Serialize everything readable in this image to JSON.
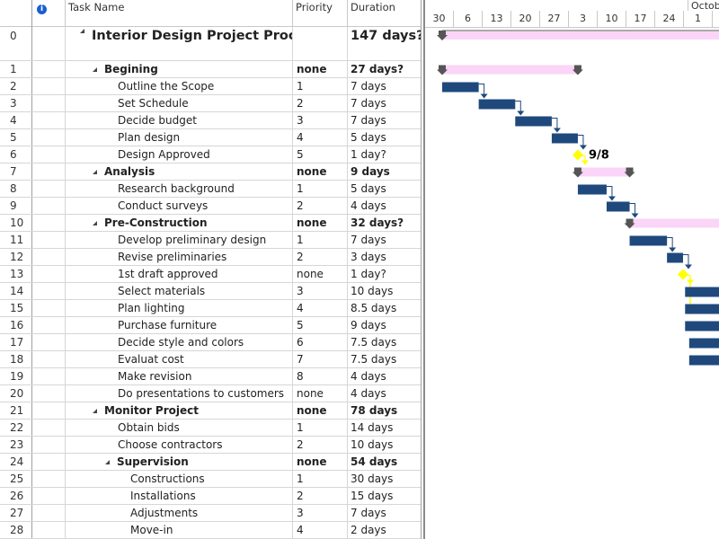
{
  "columns": {
    "id": "",
    "indicators_icon": "info-icon",
    "name": "Task Name",
    "priority": "Priority",
    "duration": "Duration"
  },
  "colors": {
    "task_bar": "#1f497d",
    "summary_bar": "#fad5f7",
    "summary_marker": "#555555",
    "milestone": "#ffff00",
    "info_icon": "#1a5fd0"
  },
  "timeline": {
    "month_label": "Octobe",
    "ticks": [
      "30",
      "6",
      "13",
      "20",
      "27",
      "3",
      "10",
      "17",
      "24",
      "1"
    ]
  },
  "tasks": [
    {
      "id": "0",
      "name": "Interior Design Project Process",
      "priority": "",
      "duration": "147 days?",
      "level": 0,
      "summary": true,
      "project": true
    },
    {
      "id": "1",
      "name": "Begining",
      "priority": "none",
      "duration": "27 days?",
      "level": 1,
      "summary": true
    },
    {
      "id": "2",
      "name": "Outline the Scope",
      "priority": "1",
      "duration": "7 days",
      "level": 2
    },
    {
      "id": "3",
      "name": "Set Schedule",
      "priority": "2",
      "duration": "7 days",
      "level": 2
    },
    {
      "id": "4",
      "name": "Decide budget",
      "priority": "3",
      "duration": "7 days",
      "level": 2
    },
    {
      "id": "5",
      "name": "Plan design",
      "priority": "4",
      "duration": "5 days",
      "level": 2
    },
    {
      "id": "6",
      "name": "Design Approved",
      "priority": "5",
      "duration": "1 day?",
      "level": 2
    },
    {
      "id": "7",
      "name": "Analysis",
      "priority": "none",
      "duration": "9 days",
      "level": 1,
      "summary": true
    },
    {
      "id": "8",
      "name": "Research background",
      "priority": "1",
      "duration": "5 days",
      "level": 2
    },
    {
      "id": "9",
      "name": "Conduct surveys",
      "priority": "2",
      "duration": "4 days",
      "level": 2
    },
    {
      "id": "10",
      "name": "Pre-Construction",
      "priority": "none",
      "duration": "32 days?",
      "level": 1,
      "summary": true
    },
    {
      "id": "11",
      "name": "Develop preliminary design",
      "priority": "1",
      "duration": "7 days",
      "level": 2
    },
    {
      "id": "12",
      "name": "Revise preliminaries",
      "priority": "2",
      "duration": "3 days",
      "level": 2
    },
    {
      "id": "13",
      "name": "1st draft approved",
      "priority": "none",
      "duration": "1 day?",
      "level": 2
    },
    {
      "id": "14",
      "name": "Select materials",
      "priority": "3",
      "duration": "10 days",
      "level": 2
    },
    {
      "id": "15",
      "name": "Plan lighting",
      "priority": "4",
      "duration": "8.5 days",
      "level": 2
    },
    {
      "id": "16",
      "name": "Purchase furniture",
      "priority": "5",
      "duration": "9 days",
      "level": 2
    },
    {
      "id": "17",
      "name": "Decide style and colors",
      "priority": "6",
      "duration": "7.5 days",
      "level": 2
    },
    {
      "id": "18",
      "name": "Evaluat cost",
      "priority": "7",
      "duration": "7.5 days",
      "level": 2
    },
    {
      "id": "19",
      "name": "Make revision",
      "priority": "8",
      "duration": "4 days",
      "level": 2
    },
    {
      "id": "20",
      "name": "Do presentations to customers",
      "priority": "none",
      "duration": "4 days",
      "level": 2
    },
    {
      "id": "21",
      "name": "Monitor Project",
      "priority": "none",
      "duration": "78 days",
      "level": 1,
      "summary": true
    },
    {
      "id": "22",
      "name": "Obtain bids",
      "priority": "1",
      "duration": "14 days",
      "level": 2
    },
    {
      "id": "23",
      "name": "Choose contractors",
      "priority": "2",
      "duration": "10 days",
      "level": 2
    },
    {
      "id": "24",
      "name": "Supervision",
      "priority": "none",
      "duration": "54 days",
      "level": 2,
      "summary": true
    },
    {
      "id": "25",
      "name": "Constructions",
      "priority": "1",
      "duration": "30 days",
      "level": 3
    },
    {
      "id": "26",
      "name": "Installations",
      "priority": "2",
      "duration": "15 days",
      "level": 3
    },
    {
      "id": "27",
      "name": "Adjustments",
      "priority": "3",
      "duration": "7 days",
      "level": 3
    },
    {
      "id": "28",
      "name": "Move-in",
      "priority": "4",
      "duration": "2 days",
      "level": 3
    }
  ],
  "milestones": [
    {
      "task_id": "6",
      "label": "9/8"
    },
    {
      "task_id": "13",
      "label": ""
    }
  ]
}
